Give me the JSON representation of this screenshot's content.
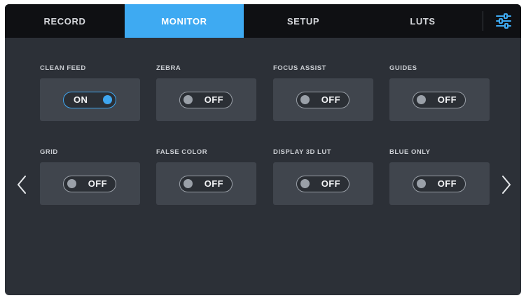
{
  "tabs": [
    {
      "label": "RECORD",
      "active": false
    },
    {
      "label": "MONITOR",
      "active": true
    },
    {
      "label": "SETUP",
      "active": false
    },
    {
      "label": "LUTS",
      "active": false
    }
  ],
  "header": {
    "settings_icon": "sliders-icon"
  },
  "monitor": {
    "items": [
      {
        "label": "CLEAN FEED",
        "state": "ON"
      },
      {
        "label": "ZEBRA",
        "state": "OFF"
      },
      {
        "label": "FOCUS ASSIST",
        "state": "OFF"
      },
      {
        "label": "GUIDES",
        "state": "OFF"
      },
      {
        "label": "GRID",
        "state": "OFF"
      },
      {
        "label": "FALSE COLOR",
        "state": "OFF"
      },
      {
        "label": "DISPLAY 3D LUT",
        "state": "OFF"
      },
      {
        "label": "BLUE ONLY",
        "state": "OFF"
      }
    ]
  },
  "nav": {
    "prev_icon": "chevron-left-icon",
    "next_icon": "chevron-right-icon"
  },
  "colors": {
    "accent": "#3eaaf2",
    "tab_bar": "#0f1013",
    "background": "#2c3037",
    "card": "#40454d",
    "toggle_off": "#9aa0a8"
  }
}
